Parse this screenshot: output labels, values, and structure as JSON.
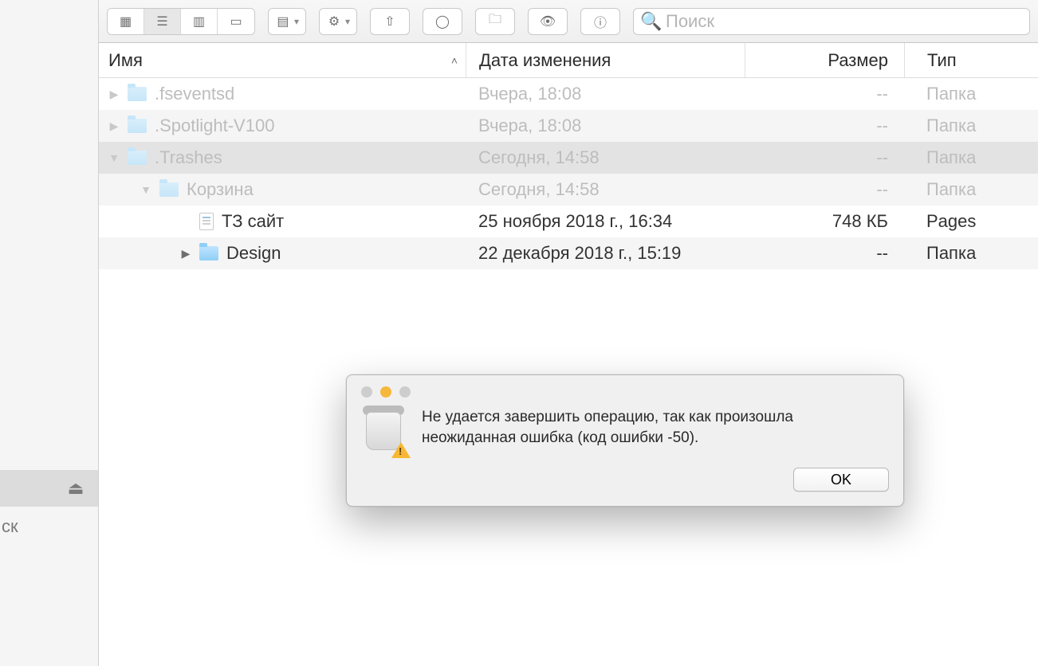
{
  "toolbar": {
    "search_placeholder": "Поиск"
  },
  "sidebar": {
    "disk_label": "ск"
  },
  "columns": {
    "name": "Имя",
    "date": "Дата изменения",
    "size": "Размер",
    "type": "Тип"
  },
  "rows": [
    {
      "indent": 0,
      "expanded": false,
      "hasChildren": true,
      "dimmed": true,
      "kind": "folder",
      "name": ".fseventsd",
      "date": "Вчера, 18:08",
      "size": "--",
      "type": "Папка"
    },
    {
      "indent": 0,
      "expanded": false,
      "hasChildren": true,
      "dimmed": true,
      "kind": "folder",
      "name": ".Spotlight-V100",
      "date": "Вчера, 18:08",
      "size": "--",
      "type": "Папка"
    },
    {
      "indent": 0,
      "expanded": true,
      "hasChildren": true,
      "dimmed": true,
      "kind": "folder",
      "name": ".Trashes",
      "date": "Сегодня, 14:58",
      "size": "--",
      "type": "Папка",
      "selected": true
    },
    {
      "indent": 1,
      "expanded": true,
      "hasChildren": true,
      "dimmed": true,
      "kind": "folder",
      "name": "Корзина",
      "date": "Сегодня, 14:58",
      "size": "--",
      "type": "Папка"
    },
    {
      "indent": 2,
      "expanded": false,
      "hasChildren": false,
      "dimmed": false,
      "kind": "file",
      "name": "ТЗ сайт",
      "date": "25 ноября 2018 г., 16:34",
      "size": "748 КБ",
      "type": "Pages"
    },
    {
      "indent": 2,
      "expanded": false,
      "hasChildren": true,
      "dimmed": false,
      "kind": "folder",
      "name": "Design",
      "date": "22 декабря 2018 г., 15:19",
      "size": "--",
      "type": "Папка"
    }
  ],
  "dialog": {
    "message": "Не удается завершить операцию, так как произошла неожиданная ошибка (код ошибки -50).",
    "ok_label": "OK"
  }
}
